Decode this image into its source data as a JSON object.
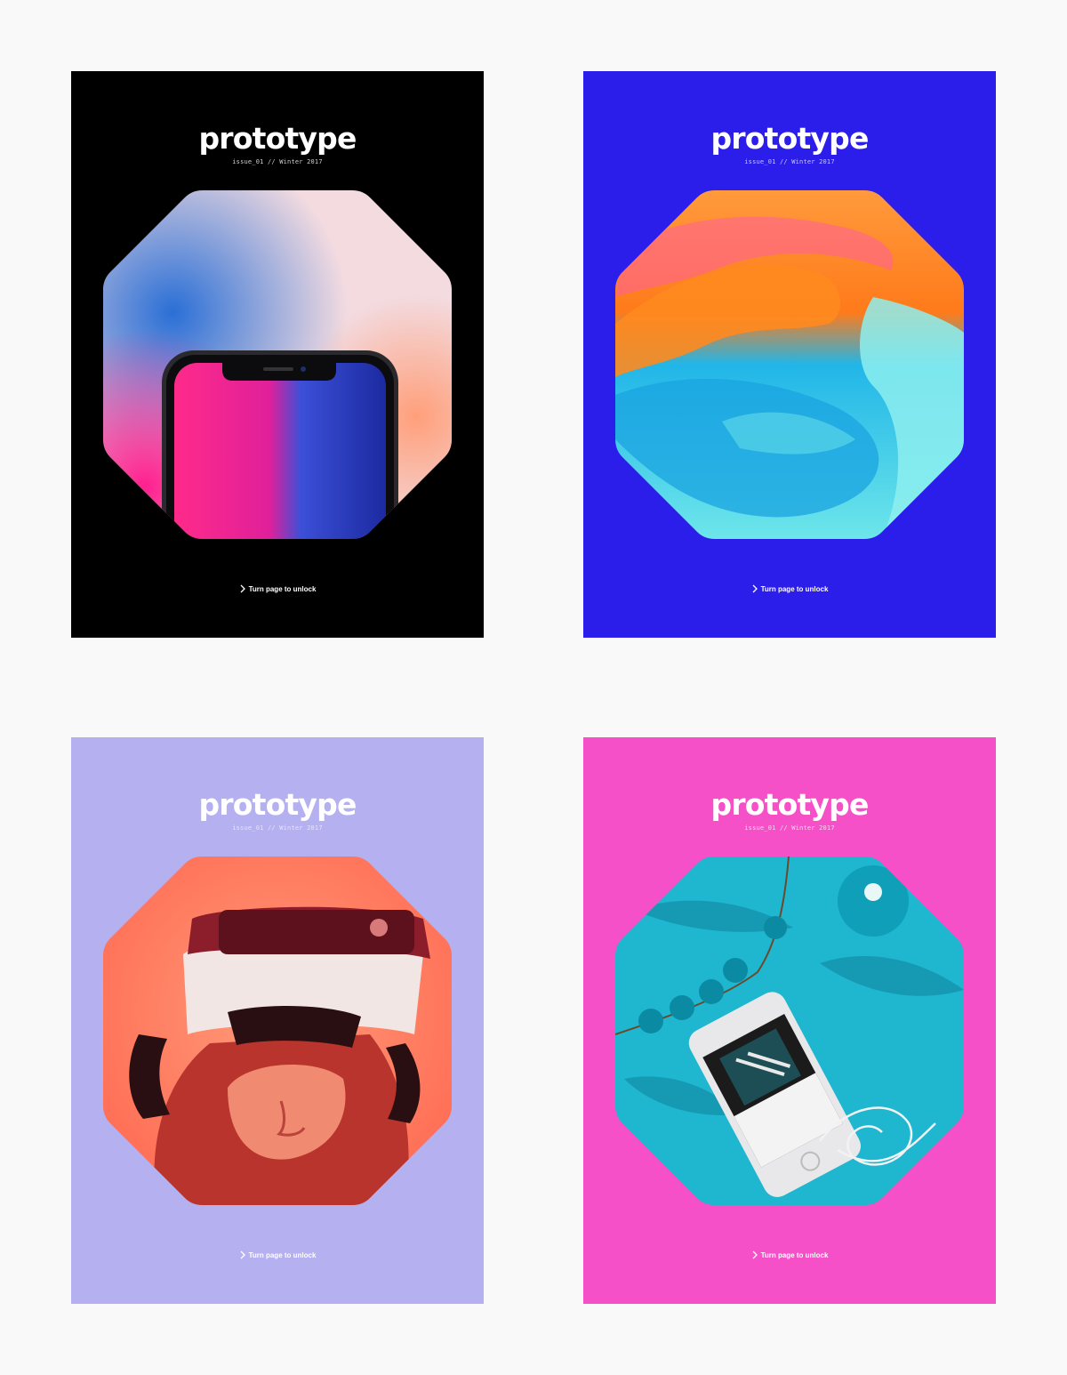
{
  "colors": {
    "page_background": "#f9f9f9"
  },
  "covers": [
    {
      "name": "black-cover",
      "background": "#000000",
      "text_color": "#ffffff",
      "issue_color": "#cfcfcf",
      "logo": "prototype",
      "issue": "issue_01 // Winter 2017",
      "cta": "Turn page to unlock",
      "icon": "chevron-right-icon",
      "image": "smartphone-gradient"
    },
    {
      "name": "blue-cover",
      "background": "#2b1dea",
      "text_color": "#ffffff",
      "issue_color": "#c9c6ff",
      "logo": "prototype",
      "issue": "issue_01 // Winter 2017",
      "cta": "Turn page to unlock",
      "icon": "chevron-right-icon",
      "image": "paint-swirl"
    },
    {
      "name": "lavender-cover",
      "background": "#b5b0f0",
      "text_color": "#ffffff",
      "issue_color": "#e6e3ff",
      "logo": "prototype",
      "issue": "issue_01 // Winter 2017",
      "cta": "Turn page to unlock",
      "icon": "chevron-right-icon",
      "image": "vr-headset"
    },
    {
      "name": "pink-cover",
      "background": "#f550c7",
      "text_color": "#ffffff",
      "issue_color": "#ffd3f2",
      "logo": "prototype",
      "issue": "issue_01 // Winter 2017",
      "cta": "Turn page to unlock",
      "icon": "chevron-right-icon",
      "image": "phone-and-earbuds"
    }
  ]
}
